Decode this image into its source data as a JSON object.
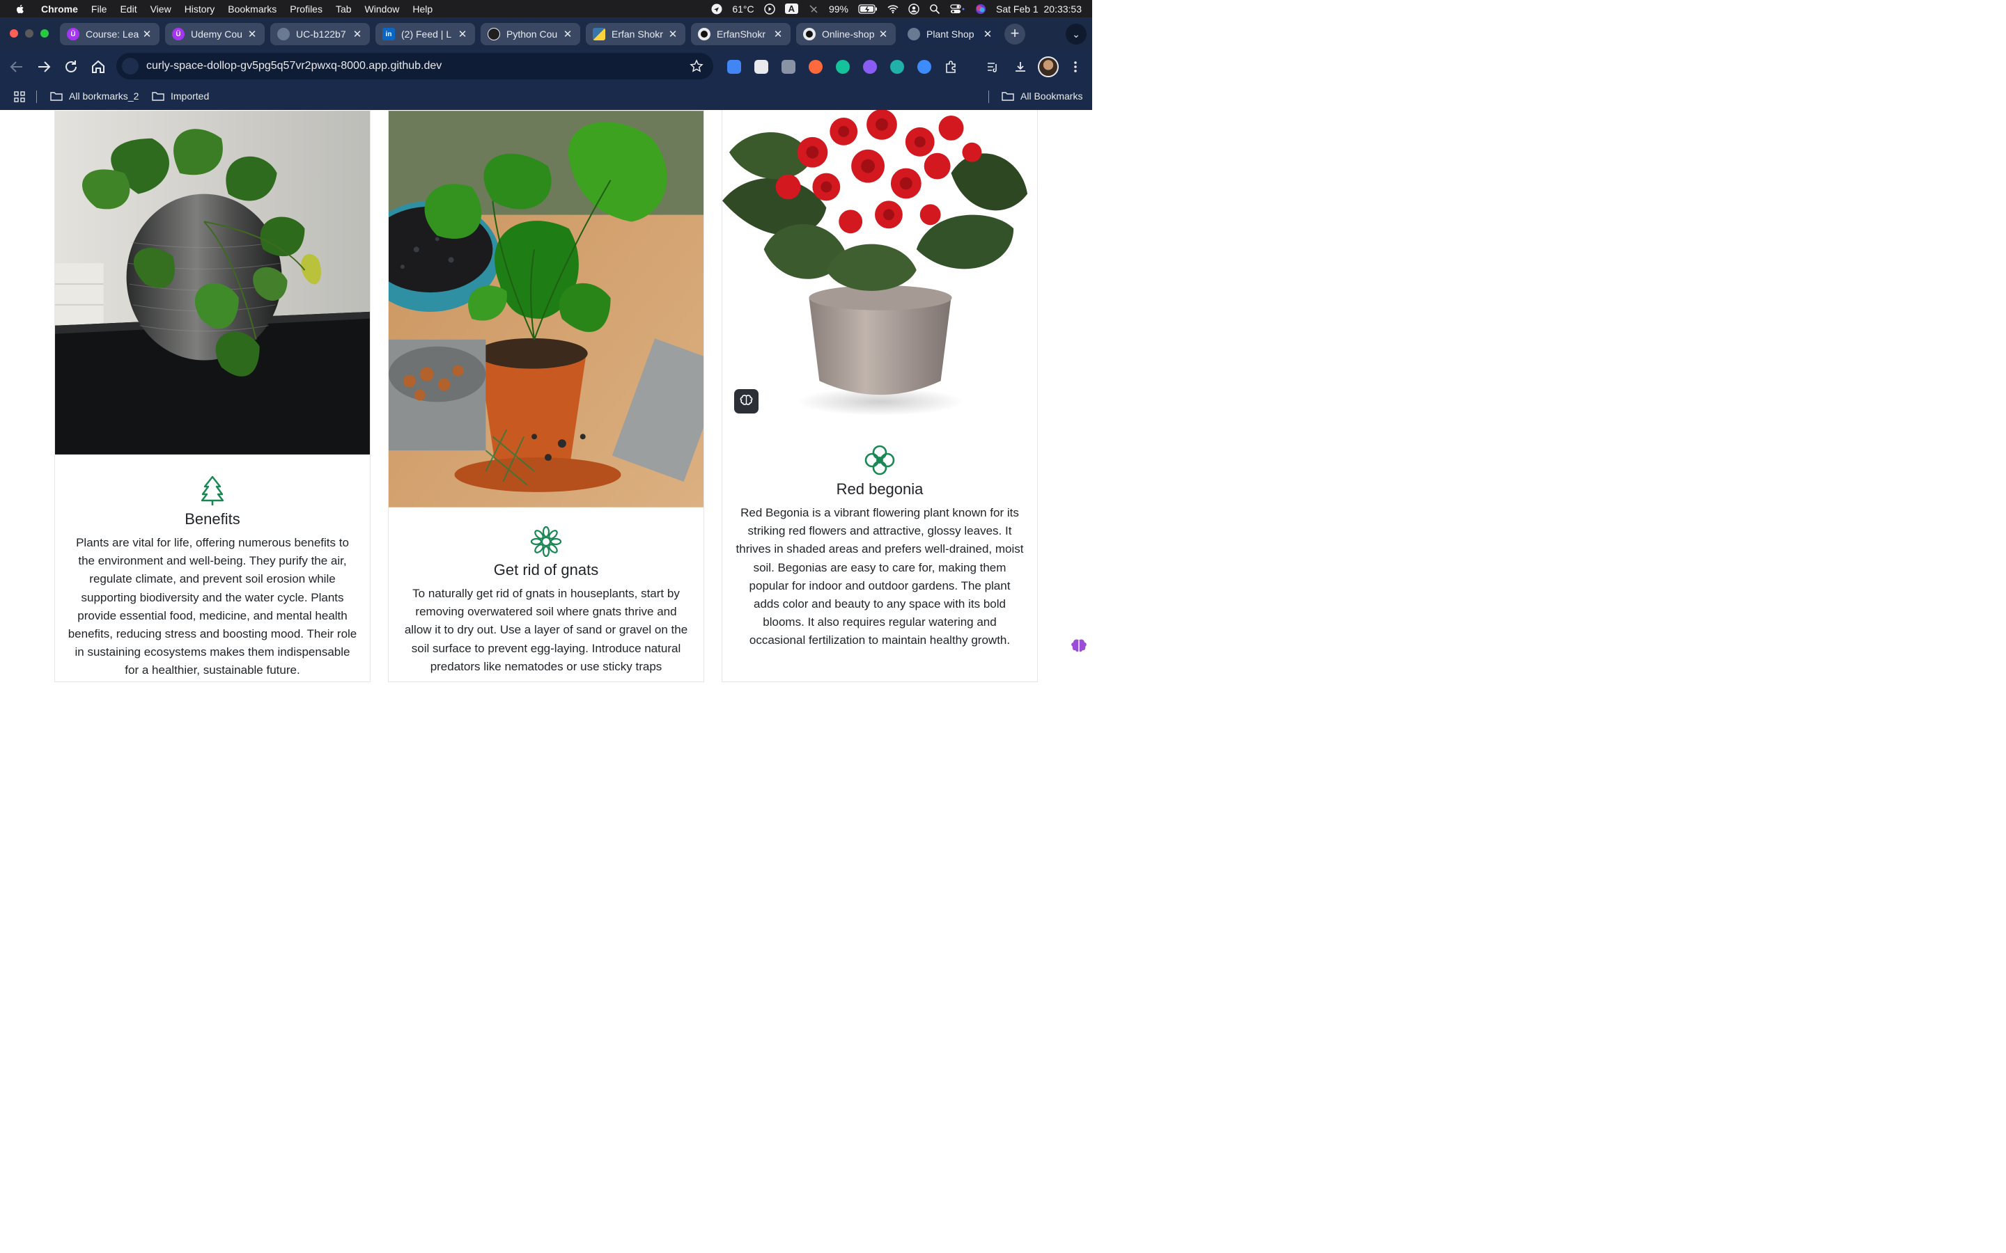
{
  "menubar": {
    "app": "Chrome",
    "items": [
      "File",
      "Edit",
      "View",
      "History",
      "Bookmarks",
      "Profiles",
      "Tab",
      "Window",
      "Help"
    ],
    "temperature": "61°C",
    "input_indicator": "A",
    "battery": "99%",
    "datetime": "Sat Feb 1  20:33:53"
  },
  "tabs": [
    {
      "title": "Course: Lea",
      "icon": "udemy-icon",
      "color": "#a435f0"
    },
    {
      "title": "Udemy Cou",
      "icon": "udemy-icon",
      "color": "#a435f0"
    },
    {
      "title": "UC-b122b7",
      "icon": "globe-icon",
      "color": "#6b7a93"
    },
    {
      "title": "(2) Feed | L",
      "icon": "linkedin-icon",
      "color": "#0a66c2"
    },
    {
      "title": "Python Cou",
      "icon": "openai-icon",
      "color": "#1f1f1f"
    },
    {
      "title": "Erfan Shokr",
      "icon": "python-icon",
      "color": "#3776ab"
    },
    {
      "title": "ErfanShokr",
      "icon": "github-icon",
      "color": "#111"
    },
    {
      "title": "Online-shop",
      "icon": "github-icon",
      "color": "#111"
    },
    {
      "title": "Plant Shop",
      "icon": "globe-icon",
      "color": "#6b7a93"
    }
  ],
  "omnibox": {
    "url": "curly-space-dollop-gv5pg5q57vr2pwxq-8000.app.github.dev"
  },
  "bookmarks": {
    "folder1": "All borkmarks_2",
    "folder2": "Imported",
    "all": "All Bookmarks"
  },
  "cards": [
    {
      "title": "Benefits",
      "icon": "tree-icon",
      "text": "Plants are vital for life, offering numerous benefits to the environment and well-being. They purify the air, regulate climate, and prevent soil erosion while supporting biodiversity and the water cycle. Plants provide essential food, medicine, and mental health benefits, reducing stress and boosting mood. Their role in sustaining ecosystems makes them indispensable for a healthier, sustainable future."
    },
    {
      "title": "Get rid of gnats",
      "icon": "flower-icon",
      "text": "To naturally get rid of gnats in houseplants, start by removing overwatered soil where gnats thrive and allow it to dry out. Use a layer of sand or gravel on the soil surface to prevent egg-laying. Introduce natural predators like nematodes or use sticky traps"
    },
    {
      "title": "Red begonia",
      "icon": "flower2-icon",
      "text": "Red Begonia is a vibrant flowering plant known for its striking red flowers and attractive, glossy leaves. It thrives in shaded areas and prefers well-drained, moist soil. Begonias are easy to care for, making them popular for indoor and outdoor gardens. The plant adds color and beauty to any space with its bold blooms. It also requires regular watering and occasional fertilization to maintain healthy growth."
    }
  ],
  "accent_color": "#198754"
}
